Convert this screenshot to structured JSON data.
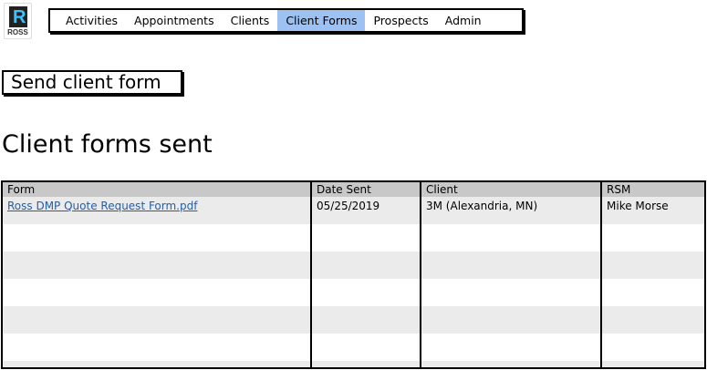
{
  "logo": {
    "text": "ROSS",
    "letter": "R"
  },
  "nav": {
    "items": [
      "Activities",
      "Appointments",
      "Clients",
      "Client Forms",
      "Prospects",
      "Admin"
    ],
    "active": "Client Forms"
  },
  "send_button": "Send client form",
  "section_title": "Client forms sent",
  "table": {
    "headers": [
      "Form",
      "Date Sent",
      "Client",
      "RSM"
    ],
    "rows": [
      {
        "form": "Ross DMP Quote Request Form.pdf",
        "date_sent": "05/25/2019",
        "client": "3M (Alexandria, MN)",
        "rsm": "Mike Morse"
      }
    ]
  },
  "colors": {
    "active_tab": "#9cc1f2",
    "link": "#1f5fae",
    "header_bg": "#c8c8c8",
    "stripe": "#ebebeb"
  }
}
